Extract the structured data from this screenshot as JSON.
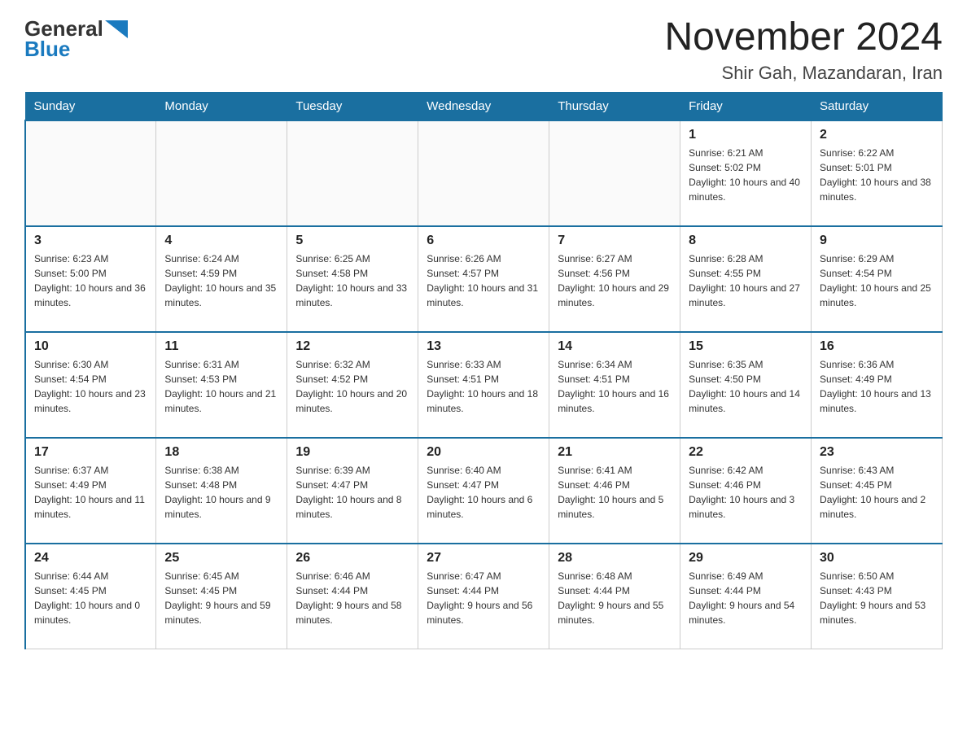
{
  "logo": {
    "general": "General",
    "blue": "Blue"
  },
  "title": "November 2024",
  "subtitle": "Shir Gah, Mazandaran, Iran",
  "days_of_week": [
    "Sunday",
    "Monday",
    "Tuesday",
    "Wednesday",
    "Thursday",
    "Friday",
    "Saturday"
  ],
  "weeks": [
    [
      {
        "day": "",
        "info": ""
      },
      {
        "day": "",
        "info": ""
      },
      {
        "day": "",
        "info": ""
      },
      {
        "day": "",
        "info": ""
      },
      {
        "day": "",
        "info": ""
      },
      {
        "day": "1",
        "info": "Sunrise: 6:21 AM\nSunset: 5:02 PM\nDaylight: 10 hours and 40 minutes."
      },
      {
        "day": "2",
        "info": "Sunrise: 6:22 AM\nSunset: 5:01 PM\nDaylight: 10 hours and 38 minutes."
      }
    ],
    [
      {
        "day": "3",
        "info": "Sunrise: 6:23 AM\nSunset: 5:00 PM\nDaylight: 10 hours and 36 minutes."
      },
      {
        "day": "4",
        "info": "Sunrise: 6:24 AM\nSunset: 4:59 PM\nDaylight: 10 hours and 35 minutes."
      },
      {
        "day": "5",
        "info": "Sunrise: 6:25 AM\nSunset: 4:58 PM\nDaylight: 10 hours and 33 minutes."
      },
      {
        "day": "6",
        "info": "Sunrise: 6:26 AM\nSunset: 4:57 PM\nDaylight: 10 hours and 31 minutes."
      },
      {
        "day": "7",
        "info": "Sunrise: 6:27 AM\nSunset: 4:56 PM\nDaylight: 10 hours and 29 minutes."
      },
      {
        "day": "8",
        "info": "Sunrise: 6:28 AM\nSunset: 4:55 PM\nDaylight: 10 hours and 27 minutes."
      },
      {
        "day": "9",
        "info": "Sunrise: 6:29 AM\nSunset: 4:54 PM\nDaylight: 10 hours and 25 minutes."
      }
    ],
    [
      {
        "day": "10",
        "info": "Sunrise: 6:30 AM\nSunset: 4:54 PM\nDaylight: 10 hours and 23 minutes."
      },
      {
        "day": "11",
        "info": "Sunrise: 6:31 AM\nSunset: 4:53 PM\nDaylight: 10 hours and 21 minutes."
      },
      {
        "day": "12",
        "info": "Sunrise: 6:32 AM\nSunset: 4:52 PM\nDaylight: 10 hours and 20 minutes."
      },
      {
        "day": "13",
        "info": "Sunrise: 6:33 AM\nSunset: 4:51 PM\nDaylight: 10 hours and 18 minutes."
      },
      {
        "day": "14",
        "info": "Sunrise: 6:34 AM\nSunset: 4:51 PM\nDaylight: 10 hours and 16 minutes."
      },
      {
        "day": "15",
        "info": "Sunrise: 6:35 AM\nSunset: 4:50 PM\nDaylight: 10 hours and 14 minutes."
      },
      {
        "day": "16",
        "info": "Sunrise: 6:36 AM\nSunset: 4:49 PM\nDaylight: 10 hours and 13 minutes."
      }
    ],
    [
      {
        "day": "17",
        "info": "Sunrise: 6:37 AM\nSunset: 4:49 PM\nDaylight: 10 hours and 11 minutes."
      },
      {
        "day": "18",
        "info": "Sunrise: 6:38 AM\nSunset: 4:48 PM\nDaylight: 10 hours and 9 minutes."
      },
      {
        "day": "19",
        "info": "Sunrise: 6:39 AM\nSunset: 4:47 PM\nDaylight: 10 hours and 8 minutes."
      },
      {
        "day": "20",
        "info": "Sunrise: 6:40 AM\nSunset: 4:47 PM\nDaylight: 10 hours and 6 minutes."
      },
      {
        "day": "21",
        "info": "Sunrise: 6:41 AM\nSunset: 4:46 PM\nDaylight: 10 hours and 5 minutes."
      },
      {
        "day": "22",
        "info": "Sunrise: 6:42 AM\nSunset: 4:46 PM\nDaylight: 10 hours and 3 minutes."
      },
      {
        "day": "23",
        "info": "Sunrise: 6:43 AM\nSunset: 4:45 PM\nDaylight: 10 hours and 2 minutes."
      }
    ],
    [
      {
        "day": "24",
        "info": "Sunrise: 6:44 AM\nSunset: 4:45 PM\nDaylight: 10 hours and 0 minutes."
      },
      {
        "day": "25",
        "info": "Sunrise: 6:45 AM\nSunset: 4:45 PM\nDaylight: 9 hours and 59 minutes."
      },
      {
        "day": "26",
        "info": "Sunrise: 6:46 AM\nSunset: 4:44 PM\nDaylight: 9 hours and 58 minutes."
      },
      {
        "day": "27",
        "info": "Sunrise: 6:47 AM\nSunset: 4:44 PM\nDaylight: 9 hours and 56 minutes."
      },
      {
        "day": "28",
        "info": "Sunrise: 6:48 AM\nSunset: 4:44 PM\nDaylight: 9 hours and 55 minutes."
      },
      {
        "day": "29",
        "info": "Sunrise: 6:49 AM\nSunset: 4:44 PM\nDaylight: 9 hours and 54 minutes."
      },
      {
        "day": "30",
        "info": "Sunrise: 6:50 AM\nSunset: 4:43 PM\nDaylight: 9 hours and 53 minutes."
      }
    ]
  ],
  "colors": {
    "header_bg": "#1a6fa0",
    "header_text": "#ffffff",
    "border": "#cccccc",
    "day_number": "#222222",
    "day_info": "#333333"
  }
}
